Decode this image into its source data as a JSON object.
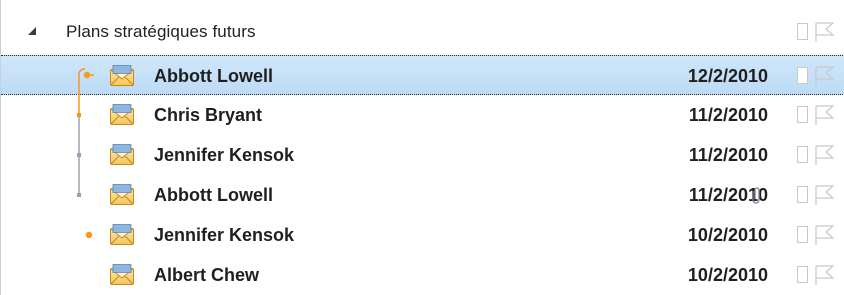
{
  "group": {
    "label": "Plans stratégiques futurs"
  },
  "messages": [
    {
      "sender": "Abbott Lowell",
      "date": "12/2/2010",
      "selected": true,
      "attachment": false
    },
    {
      "sender": "Chris Bryant",
      "date": "11/2/2010",
      "selected": false,
      "attachment": false
    },
    {
      "sender": "Jennifer Kensok",
      "date": "11/2/2010",
      "selected": false,
      "attachment": false
    },
    {
      "sender": "Abbott Lowell",
      "date": "11/2/2010",
      "selected": false,
      "attachment": true
    },
    {
      "sender": "Jennifer Kensok",
      "date": "10/2/2010",
      "selected": false,
      "attachment": false
    },
    {
      "sender": "Albert Chew",
      "date": "10/2/2010",
      "selected": false,
      "attachment": false
    }
  ],
  "colors": {
    "selection": "#c6e0f8",
    "thread_orange": "#f39a1d",
    "thread_gray": "#9aa3ad"
  },
  "icons": {
    "expand": "collapse-triangle-icon",
    "message": "envelope-icon",
    "attachment": "paperclip-icon",
    "category": "category-box-icon",
    "flag": "flag-icon"
  }
}
